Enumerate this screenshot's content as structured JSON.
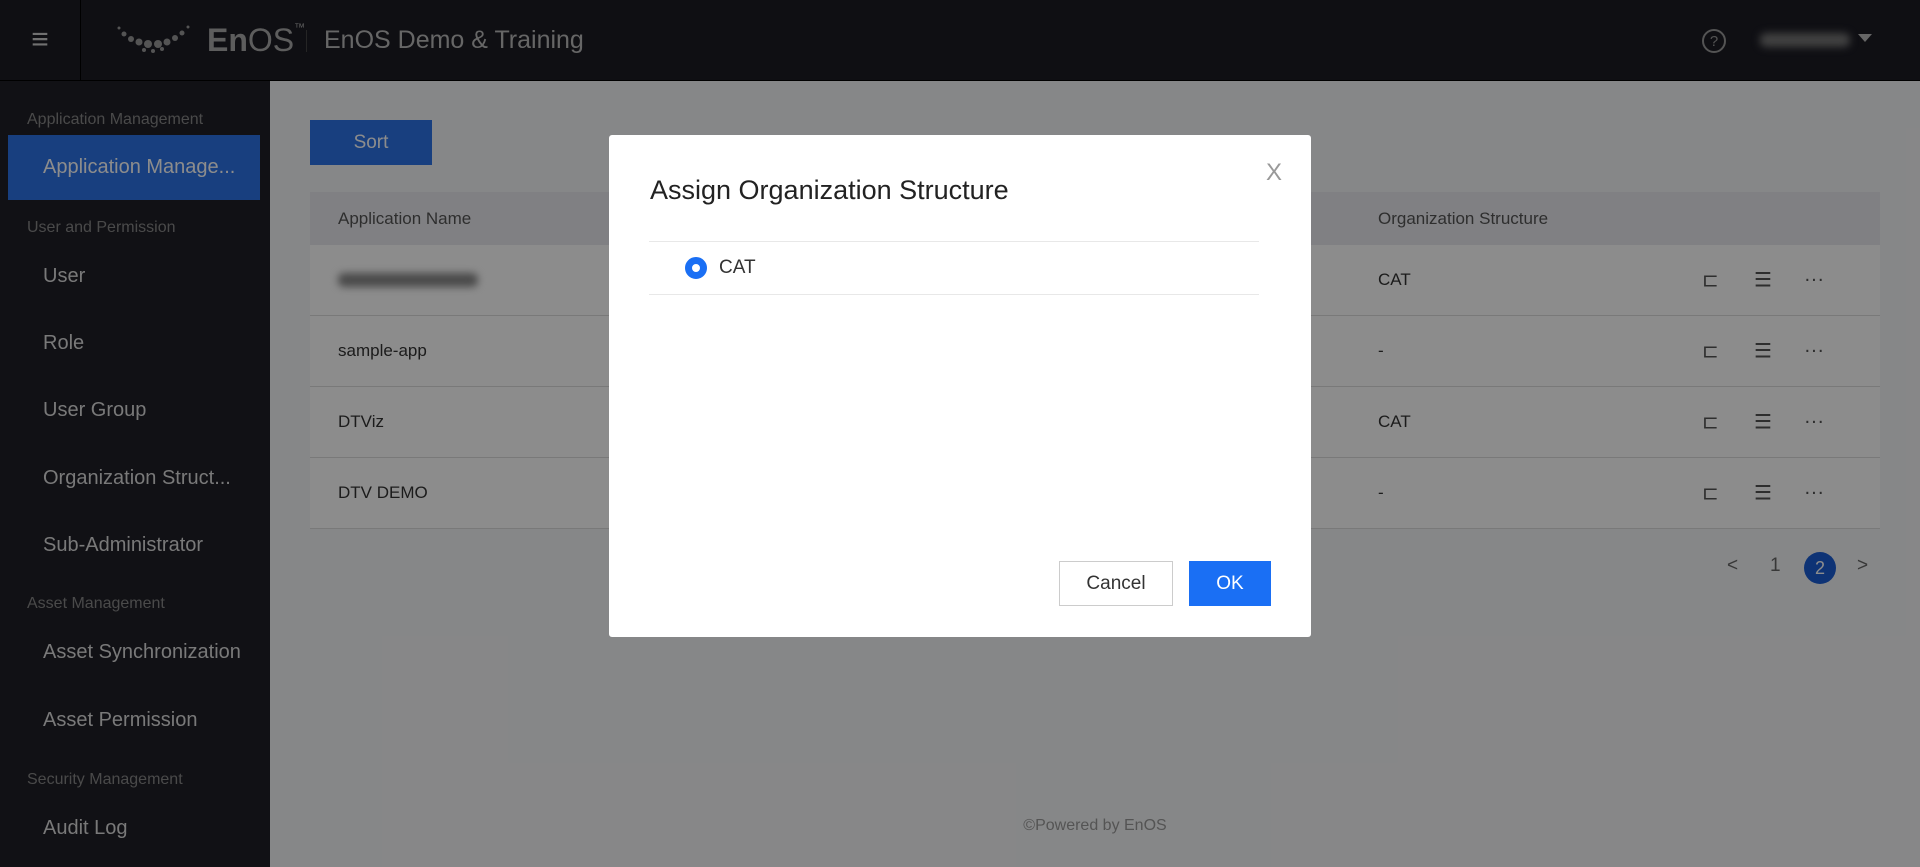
{
  "header": {
    "brand": "En",
    "brand_suffix": "OS",
    "tm": "™",
    "title": "EnOS Demo & Training",
    "help_icon": "question-circle-icon",
    "menu_icon": "hamburger-icon"
  },
  "sidebar": {
    "sections": [
      "Application Management",
      "User and Permission",
      "Asset Management",
      "Security Management"
    ],
    "items": [
      "Application Manage...",
      "User",
      "Role",
      "User Group",
      "Organization Struct...",
      "Sub-Administrator",
      "Asset Synchronization",
      "Asset Permission",
      "Audit Log"
    ],
    "active": "Application Manage..."
  },
  "main": {
    "sort_label": "Sort",
    "columns": [
      "Application Name",
      "Organization Structure"
    ],
    "rows": [
      {
        "name": "",
        "org": "CAT",
        "name_blurred": true
      },
      {
        "name": "sample-app",
        "org": "-"
      },
      {
        "name": "DTViz",
        "org": "CAT"
      },
      {
        "name": "DTV DEMO",
        "org": "-"
      }
    ],
    "row_icons": [
      "org-tree-icon",
      "list-icon",
      "more-icon"
    ],
    "pagination": {
      "prev": "<",
      "pages": [
        "1",
        "2"
      ],
      "current": "2",
      "next": ">"
    },
    "footer": "©Powered by EnOS"
  },
  "modal": {
    "title": "Assign Organization Structure",
    "close": "X",
    "options": [
      {
        "label": "CAT",
        "selected": true
      }
    ],
    "cancel": "Cancel",
    "ok": "OK"
  },
  "colors": {
    "accent": "#1a6ff4",
    "header_bg": "#1c1c24",
    "sidebar_bg": "#1f1f27"
  }
}
